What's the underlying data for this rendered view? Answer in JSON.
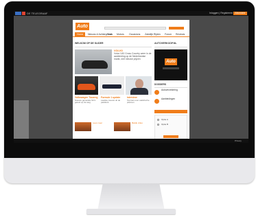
{
  "topbar": {
    "brand": "DE TELEGRAAF",
    "links": "Inloggen | Registreren",
    "cta": "Abonneer"
  },
  "site": {
    "logo": "Auto",
    "nav": [
      "Home",
      "Nieuws & Achtergrond",
      "Tests",
      "Motors",
      "Occasions",
      "Zakelijk Rijden",
      "Forum",
      "Reviews"
    ],
    "section_title": "WELKOM OP DE SLIDER",
    "feature": {
      "headline": "VOLVO",
      "text": "Volvo V40 Cross Country weer in de aanbieding op de Nederlandse markt, met nieuwe prijzen"
    },
    "columns": [
      {
        "headline": "Volkswagen Touareg",
        "text": "Nieuwe generatie SUV getest op de weg"
      },
      {
        "headline": "Formule 1 update",
        "text": "Laatste nieuws uit de paddock"
      },
      {
        "headline": "Interview",
        "text": "Topman over elektrische plannen"
      }
    ],
    "small_items": [
      "Lees meer",
      "Bekijk video"
    ],
    "right": {
      "title": "AUTOVERKOOP.NL",
      "logo": "Auto",
      "title2": "DOSSIERS",
      "items": [
        "Autoverzekering",
        "Aanbiedingen"
      ],
      "poll_labels": [
        "Optie A",
        "Optie B"
      ]
    }
  },
  "bottombar": "Privacy"
}
